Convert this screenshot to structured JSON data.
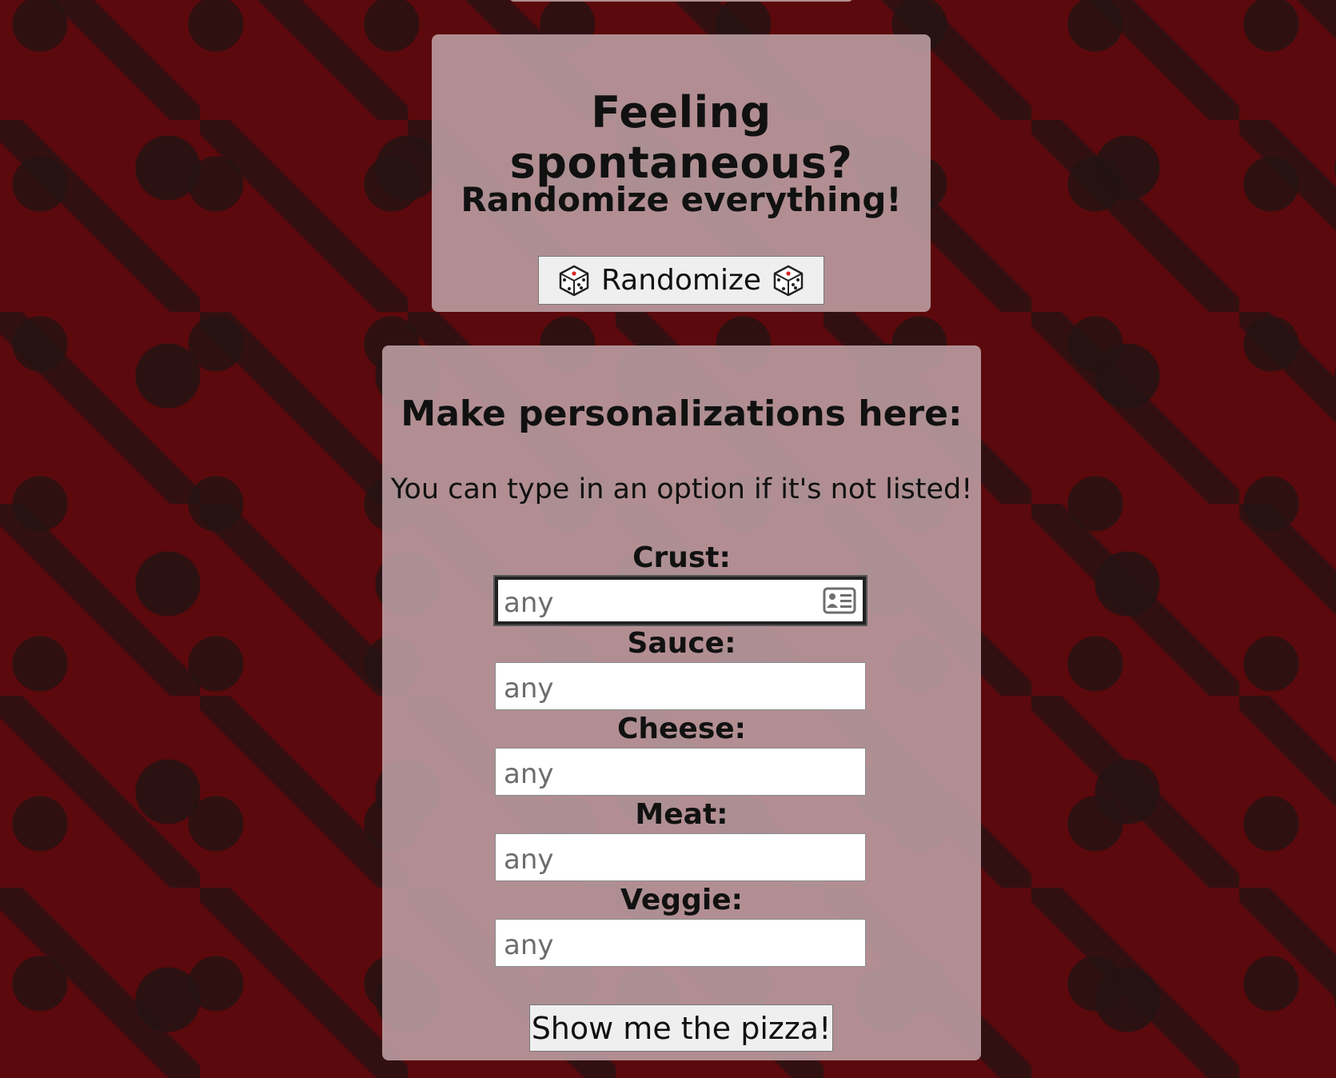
{
  "randomize_panel": {
    "title": "Feeling spontaneous?",
    "subtitle": "Randomize everything!",
    "button_label": "Randomize"
  },
  "form_panel": {
    "title": "Make personalizations here:",
    "note": "You can type in an option if it's not listed!",
    "fields": [
      {
        "label": "Crust:",
        "placeholder": "any",
        "value": ""
      },
      {
        "label": "Sauce:",
        "placeholder": "any",
        "value": ""
      },
      {
        "label": "Cheese:",
        "placeholder": "any",
        "value": ""
      },
      {
        "label": "Meat:",
        "placeholder": "any",
        "value": ""
      },
      {
        "label": "Veggie:",
        "placeholder": "any",
        "value": ""
      }
    ],
    "submit_label": "Show me the pizza!"
  },
  "colors": {
    "background": "#5b090c",
    "panel": "#bea0a5",
    "button": "#efefef"
  },
  "icons": {
    "die": "die-icon",
    "autofill": "contact-card-icon"
  }
}
